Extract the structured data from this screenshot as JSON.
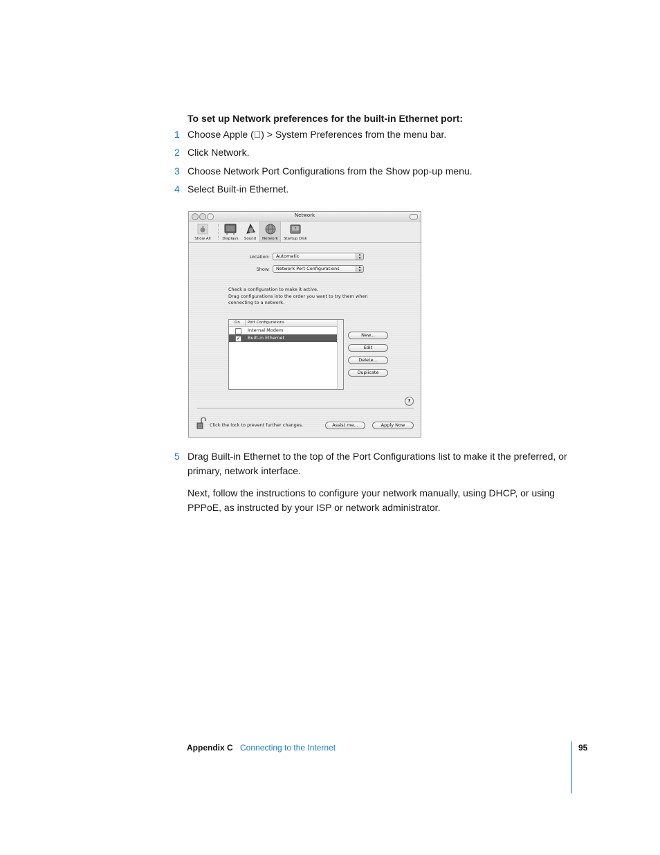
{
  "heading": "To set up Network preferences for the built-in Ethernet port:",
  "steps": [
    {
      "num": "1",
      "text": "Choose Apple () > System Preferences from the menu bar."
    },
    {
      "num": "2",
      "text": "Click Network."
    },
    {
      "num": "3",
      "text": "Choose Network Port Configurations from the Show pop-up menu."
    },
    {
      "num": "4",
      "text": "Select Built-in Ethernet."
    },
    {
      "num": "5",
      "text": "Drag Built-in Ethernet to the top of the Port Configurations list to make it the preferred, or primary, network interface."
    }
  ],
  "paragraph": "Next, follow the instructions to configure your network manually, using DHCP, or using PPPoE, as instructed by your ISP or network administrator.",
  "window": {
    "title": "Network",
    "toolbar": [
      {
        "label": "Show All",
        "icon": "apple-show-all-icon"
      },
      {
        "label": "Displays",
        "icon": "display-icon"
      },
      {
        "label": "Sound",
        "icon": "speaker-icon"
      },
      {
        "label": "Network",
        "icon": "network-globe-icon",
        "selected": true
      },
      {
        "label": "Startup Disk",
        "icon": "startup-disk-icon"
      }
    ],
    "location_label": "Location:",
    "location_value": "Automatic",
    "show_label": "Show:",
    "show_value": "Network Port Configurations",
    "info_lines": [
      "Check a configuration to make it active.",
      "Drag configurations into the order you want to try them when",
      "connecting to a network."
    ],
    "table": {
      "columns": [
        "On",
        "Port Configurations"
      ],
      "rows": [
        {
          "checked": false,
          "name": "Internal Modem",
          "selected": false
        },
        {
          "checked": true,
          "name": "Built-in Ethernet",
          "selected": true
        }
      ]
    },
    "buttons": {
      "new": "New...",
      "edit": "Edit",
      "delete": "Delete...",
      "duplicate": "Duplicate"
    },
    "help": "?",
    "lock_text": "Click the lock to prevent further changes.",
    "assist": "Assist me...",
    "apply": "Apply Now"
  },
  "footer": {
    "appendix": "Appendix C",
    "title": "Connecting to the Internet",
    "page": "95"
  },
  "colors": {
    "accent": "#1a7ac2"
  }
}
